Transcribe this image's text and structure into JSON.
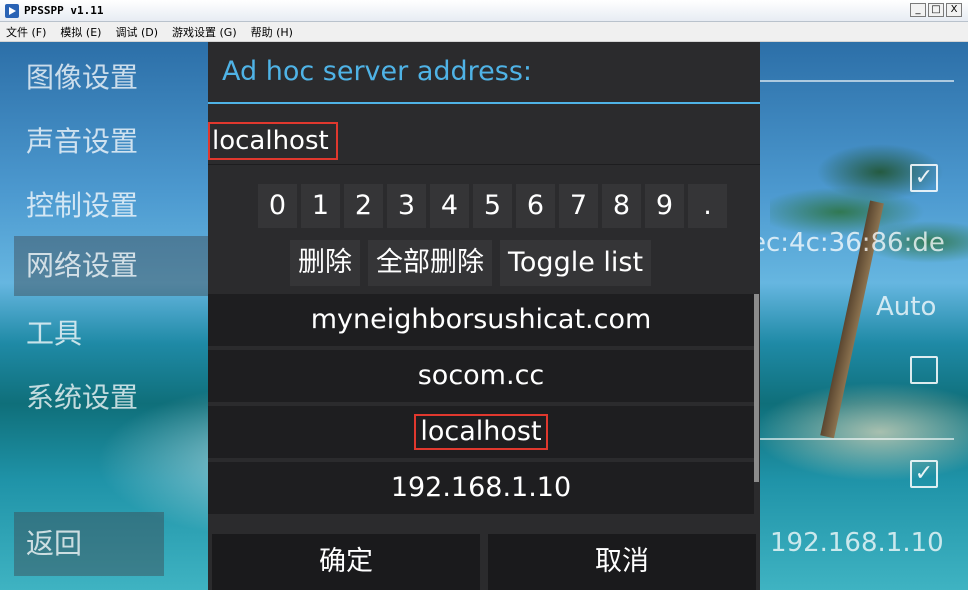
{
  "window": {
    "title": "PPSSPP v1.11",
    "controls": [
      "_",
      "□",
      "X"
    ]
  },
  "menu": [
    "文件 (F)",
    "模拟 (E)",
    "调试 (D)",
    "游戏设置 (G)",
    "帮助 (H)"
  ],
  "categories": [
    "图像设置",
    "声音设置",
    "控制设置",
    "网络设置",
    "工具",
    "系统设置"
  ],
  "selected_category": "网络设置",
  "back_label": "返回",
  "background_right": {
    "mac_partial": "ec:4c:36:86:de",
    "auto_label": "Auto",
    "ip_value": "192.168.1.10",
    "checkboxes": [
      {
        "checked": true,
        "glyph": "✓"
      },
      {
        "checked": false,
        "glyph": ""
      },
      {
        "checked": true,
        "glyph": "✓"
      }
    ]
  },
  "dialog": {
    "title": "Ad hoc server address:",
    "input_value": "localhost",
    "keypad": [
      "0",
      "1",
      "2",
      "3",
      "4",
      "5",
      "6",
      "7",
      "8",
      "9",
      "."
    ],
    "actions": [
      "删除",
      "全部删除",
      "Toggle list"
    ],
    "list": [
      "myneighborsushicat.com",
      "socom.cc",
      "localhost",
      "192.168.1.10"
    ],
    "list_selected": "localhost",
    "ok_label": "确定",
    "cancel_label": "取消"
  },
  "colors": {
    "accent": "#4fb3e6",
    "highlight_border": "#e0382e",
    "dialog_bg": "#2b2b2d"
  }
}
